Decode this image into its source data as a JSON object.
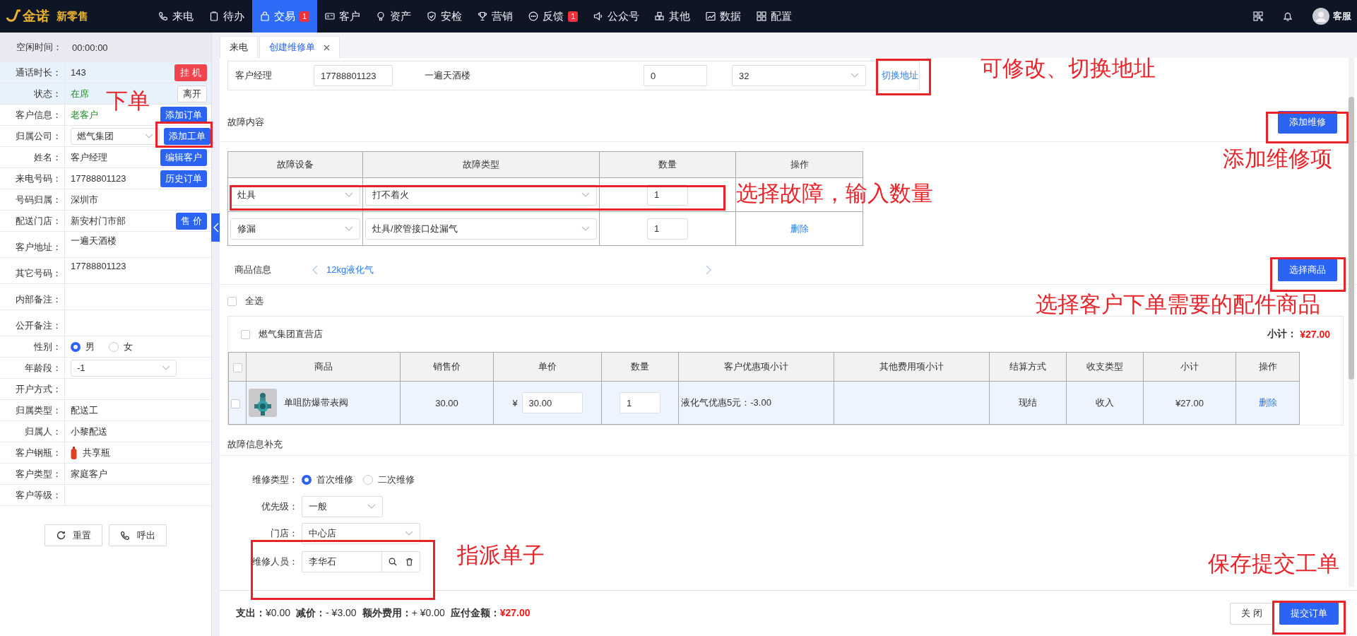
{
  "nav": {
    "logo": "金诺",
    "brand": "新零售",
    "items": [
      {
        "label": "来电",
        "selected": false
      },
      {
        "label": "待办",
        "selected": false
      },
      {
        "label": "交易",
        "selected": true,
        "badge": "1"
      },
      {
        "label": "客户",
        "selected": false
      },
      {
        "label": "资产",
        "selected": false
      },
      {
        "label": "安检",
        "selected": false
      },
      {
        "label": "营销",
        "selected": false
      },
      {
        "label": "反馈",
        "selected": false,
        "badge": "1"
      },
      {
        "label": "公众号",
        "selected": false
      },
      {
        "label": "其他",
        "selected": false
      },
      {
        "label": "数据",
        "selected": false
      },
      {
        "label": "配置",
        "selected": false
      }
    ],
    "user": "客服"
  },
  "left": {
    "idle": {
      "label": "空闲时间：",
      "value": "00:00:00"
    },
    "rows": [
      {
        "label": "通话时长：",
        "value": "143",
        "kind": "text",
        "shaded": true,
        "button": {
          "label": "挂 机",
          "kind": "danger"
        }
      },
      {
        "label": "状态：",
        "value": "在席",
        "kind": "text",
        "shaded": true,
        "status": true,
        "button": {
          "label": "离开",
          "kind": "plain"
        }
      },
      {
        "label": "客户信息：",
        "value": "老客户",
        "kind": "text",
        "status": true,
        "button": {
          "label": "添加订单",
          "kind": "primary"
        }
      },
      {
        "label": "归属公司：",
        "value": "燃气集团",
        "kind": "select",
        "button": {
          "label": "添加工单",
          "kind": "primary"
        }
      },
      {
        "label": "姓名：",
        "value": "客户经理",
        "kind": "text",
        "button": {
          "label": "编辑客户",
          "kind": "primary"
        }
      },
      {
        "label": "来电号码：",
        "value": "17788801123",
        "kind": "text",
        "button": {
          "label": "历史订单",
          "kind": "primary"
        }
      },
      {
        "label": "号码归属：",
        "value": "深圳市",
        "kind": "text"
      },
      {
        "label": "配送门店：",
        "value": "新安村门市部",
        "kind": "text",
        "button": {
          "label": "售 价",
          "kind": "primary"
        }
      },
      {
        "label": "客户地址：",
        "value": "一遍天酒楼",
        "kind": "multiline"
      },
      {
        "label": "其它号码：",
        "value": "17788801123",
        "kind": "multiline"
      },
      {
        "label": "内部备注：",
        "kind": "multiline"
      },
      {
        "label": "公开备注：",
        "kind": "multiline"
      },
      {
        "label": "性别：",
        "kind": "radio",
        "options": [
          {
            "label": "男",
            "selected": true
          },
          {
            "label": "女",
            "selected": false
          }
        ]
      },
      {
        "label": "年龄段：",
        "value": "-1",
        "kind": "select"
      },
      {
        "label": "开户方式：",
        "kind": "text"
      },
      {
        "label": "归属类型：",
        "value": "配送工",
        "kind": "text"
      },
      {
        "label": "归属人：",
        "value": "小黎配送",
        "kind": "text"
      },
      {
        "label": "客户钢瓶：",
        "value": "共享瓶",
        "kind": "bottle"
      },
      {
        "label": "客户类型：",
        "value": "家庭客户",
        "kind": "text"
      },
      {
        "label": "客户等级：",
        "kind": "text"
      }
    ],
    "buttons": [
      {
        "label": "重置"
      },
      {
        "label": "呼出"
      }
    ]
  },
  "tabs": [
    {
      "label": "来电",
      "selected": false
    },
    {
      "label": "创建维修单",
      "selected": true
    }
  ],
  "address": {
    "contact": "客户经理",
    "phone": "17788801123",
    "address": "一遍天酒楼",
    "input_value": "0",
    "select_value": "32",
    "link": "切换地址"
  },
  "fault": {
    "title": "故障内容",
    "add_button": "添加维修",
    "columns": [
      "故障设备",
      "故障类型",
      "数量",
      "操作"
    ],
    "rows": [
      {
        "device": "灶具",
        "type": "打不着火",
        "qty": "1"
      },
      {
        "device": "修漏",
        "type": "灶具/胶管接口处漏气",
        "qty": "1",
        "action": "删除"
      }
    ]
  },
  "goods": {
    "title": "商品信息",
    "current": "12kg液化气",
    "button": "选择商品",
    "select_all": {
      "label": "全选",
      "checked": false
    },
    "stores": [
      {
        "name": "燃气集团直营店",
        "checked": false,
        "subtotal_label": "小计：",
        "subtotal": "¥27.00",
        "header_checked": false,
        "columns": [
          "商品",
          "销售价",
          "单价",
          "数量",
          "客户优惠项小计",
          "其他费用项小计",
          "结算方式",
          "收支类型",
          "小计",
          "操作"
        ],
        "rows": [
          {
            "checked": false,
            "name": "单咀防爆带表阀",
            "price": "30.00",
            "currency": "¥",
            "unit_price": "30.00",
            "qty": "1",
            "discount": "液化气优惠5元：-3.00",
            "settle": "现结",
            "type": "收入",
            "subtotal": "¥27.00",
            "action": "删除"
          }
        ]
      }
    ]
  },
  "supplement": {
    "title": "故障信息补充",
    "repair_type": {
      "label": "维修类型：",
      "options": [
        {
          "label": "首次维修",
          "selected": true
        },
        {
          "label": "二次维修",
          "selected": false
        }
      ]
    },
    "priority": {
      "label": "优先级：",
      "value": "一般"
    },
    "store": {
      "label": "门店：",
      "value": "中心店"
    },
    "technician": {
      "label": "维修人员：",
      "value": "李华石"
    }
  },
  "footer": {
    "totals": [
      {
        "label": "支出：",
        "value": "¥0.00",
        "emphasis": false
      },
      {
        "label": "减价：",
        "value": "- ¥3.00",
        "emphasis": false
      },
      {
        "label": "额外费用：",
        "value": "+ ¥0.00",
        "emphasis": false
      },
      {
        "label": "应付金额：",
        "value": "¥27.00",
        "emphasis": true
      }
    ],
    "close": "关 闭",
    "submit": "提交订单"
  },
  "annotations": [
    {
      "text": "下单"
    },
    {
      "text": "可修改、切换地址"
    },
    {
      "text": "添加维修项"
    },
    {
      "text": "选择故障，输入数量"
    },
    {
      "text": "选择客户下单需要的配件商品"
    },
    {
      "text": "指派单子"
    },
    {
      "text": "保存提交工单"
    }
  ]
}
